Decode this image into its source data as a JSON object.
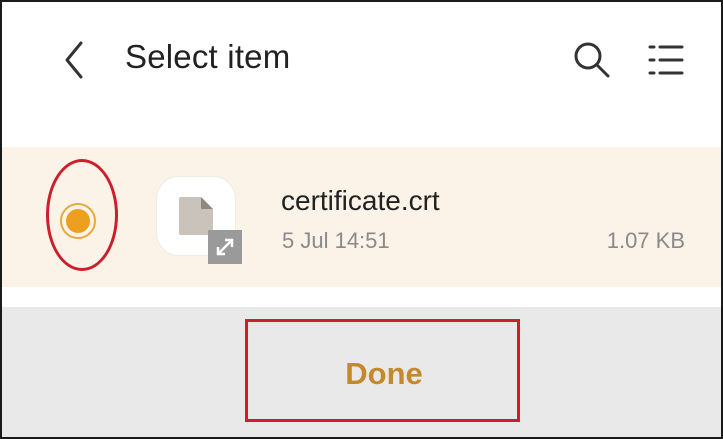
{
  "header": {
    "title": "Select item",
    "back_icon": "chevron-left-icon",
    "search_icon": "search-icon",
    "list_icon": "list-view-icon"
  },
  "file": {
    "name": "certificate.crt",
    "date": "5 Jul 14:51",
    "size": "1.07 KB",
    "selected": true,
    "thumbnail_icon": "document-icon",
    "badge_icon": "expand-icon"
  },
  "footer": {
    "done_label": "Done"
  },
  "colors": {
    "accent": "#eda01f",
    "done_text": "#c3892c",
    "row_highlight": "#fbf3e8",
    "annotation": "#cc1f2c"
  }
}
